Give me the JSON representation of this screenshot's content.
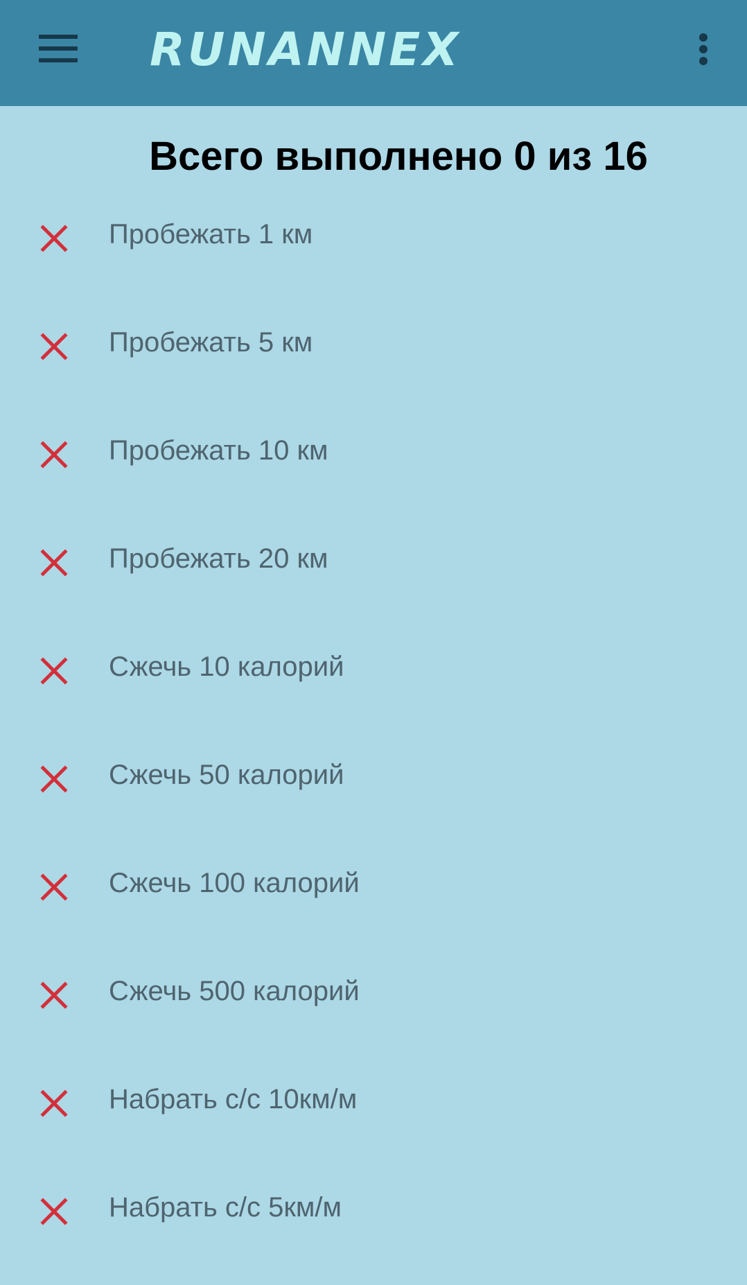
{
  "app_bar": {
    "title": "RUNANNEX",
    "menu_icon": "hamburger-menu-icon",
    "overflow_icon": "more-vert-icon",
    "background_color": "#3a86a4",
    "title_color": "#bff3f1"
  },
  "summary": {
    "text": "Всего выполнено 0 из 16"
  },
  "achievements": [
    {
      "label": "Пробежать 1 км",
      "status_icon": "cross-icon",
      "completed": false
    },
    {
      "label": "Пробежать 5 км",
      "status_icon": "cross-icon",
      "completed": false
    },
    {
      "label": "Пробежать 10 км",
      "status_icon": "cross-icon",
      "completed": false
    },
    {
      "label": "Пробежать 20 км",
      "status_icon": "cross-icon",
      "completed": false
    },
    {
      "label": "Сжечь 10 калорий",
      "status_icon": "cross-icon",
      "completed": false
    },
    {
      "label": "Сжечь 50 калорий",
      "status_icon": "cross-icon",
      "completed": false
    },
    {
      "label": "Сжечь 100 калорий",
      "status_icon": "cross-icon",
      "completed": false
    },
    {
      "label": "Сжечь 500 калорий",
      "status_icon": "cross-icon",
      "completed": false
    },
    {
      "label": "Набрать с/с 10км/м",
      "status_icon": "cross-icon",
      "completed": false
    },
    {
      "label": "Набрать с/с 5км/м",
      "status_icon": "cross-icon",
      "completed": false
    }
  ],
  "colors": {
    "page_background": "#add8e6",
    "cross_icon": "#d32f3a",
    "label_text": "#4e646f",
    "summary_text": "#000000"
  }
}
